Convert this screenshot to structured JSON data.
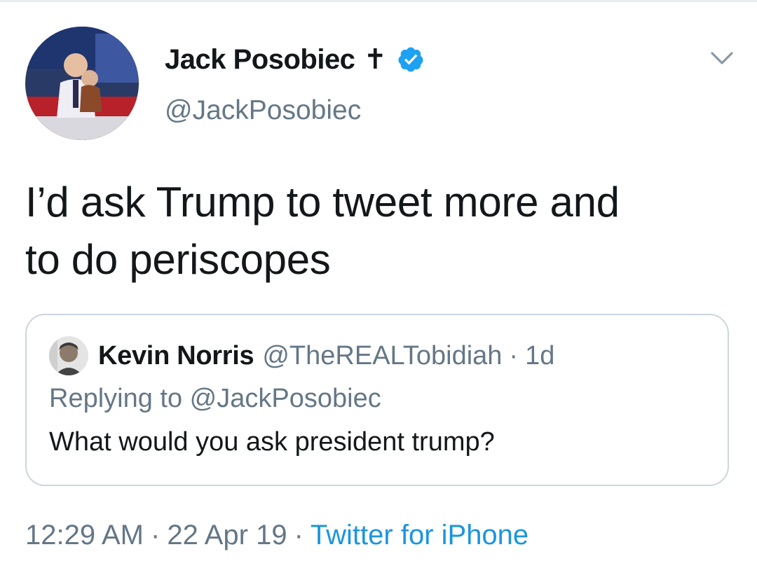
{
  "tweet": {
    "author": {
      "display_name": "Jack Posobiec",
      "name_glyph": "✝",
      "handle": "@JackPosobiec",
      "verified": true
    },
    "text_line1": "I’d ask Trump to tweet more and",
    "text_line2": "to do periscopes",
    "quoted": {
      "display_name": "Kevin Norris",
      "handle": "@TheREALTobidiah",
      "separator": "·",
      "time": "1d",
      "replying_to": "Replying to @JackPosobiec",
      "text": "What would you ask president trump?"
    },
    "meta": {
      "time": "12:29 AM",
      "separator": "·",
      "date": "22 Apr 19",
      "source": "Twitter for iPhone"
    }
  },
  "icons": {
    "verified": "verified-badge-icon",
    "more": "chevron-down-icon"
  },
  "colors": {
    "accent": "#1da1f2",
    "link": "#1b95e0",
    "secondary_text": "#657786",
    "primary_text": "#14171a",
    "border": "#ccd6dd"
  }
}
